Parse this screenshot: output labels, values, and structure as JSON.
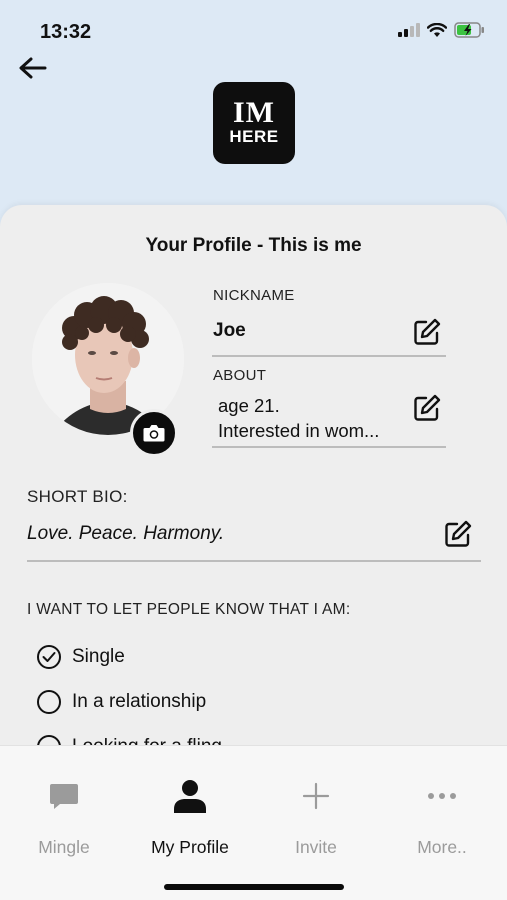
{
  "status_bar": {
    "time": "13:32"
  },
  "header": {
    "logo": {
      "line1": "IM",
      "line2": "HERE"
    }
  },
  "profile": {
    "title": "Your Profile - This is me",
    "nickname": {
      "label": "NICKNAME",
      "value": "Joe"
    },
    "about": {
      "label": "ABOUT",
      "line1": "age 21.",
      "line2": "Interested in wom..."
    },
    "short_bio": {
      "label": "SHORT BIO:",
      "value": "Love. Peace. Harmony."
    },
    "status_heading": "I WANT TO LET PEOPLE KNOW THAT I AM:",
    "options": [
      {
        "label": "Single",
        "checked": true
      },
      {
        "label": "In a relationship",
        "checked": false
      },
      {
        "label": "Looking for a fling",
        "checked": false
      }
    ]
  },
  "tab_bar": {
    "tabs": [
      {
        "label": "Mingle",
        "icon": "chat-bubble-icon",
        "active": false
      },
      {
        "label": "My Profile",
        "icon": "person-icon",
        "active": true
      },
      {
        "label": "Invite",
        "icon": "plus-icon",
        "active": false
      },
      {
        "label": "More..",
        "icon": "ellipsis-icon",
        "active": false
      }
    ]
  },
  "colors": {
    "header_background": "#dde9f5",
    "card_background": "#eeeeee",
    "tab_inactive": "#9b9b9b",
    "tab_active": "#111111"
  }
}
